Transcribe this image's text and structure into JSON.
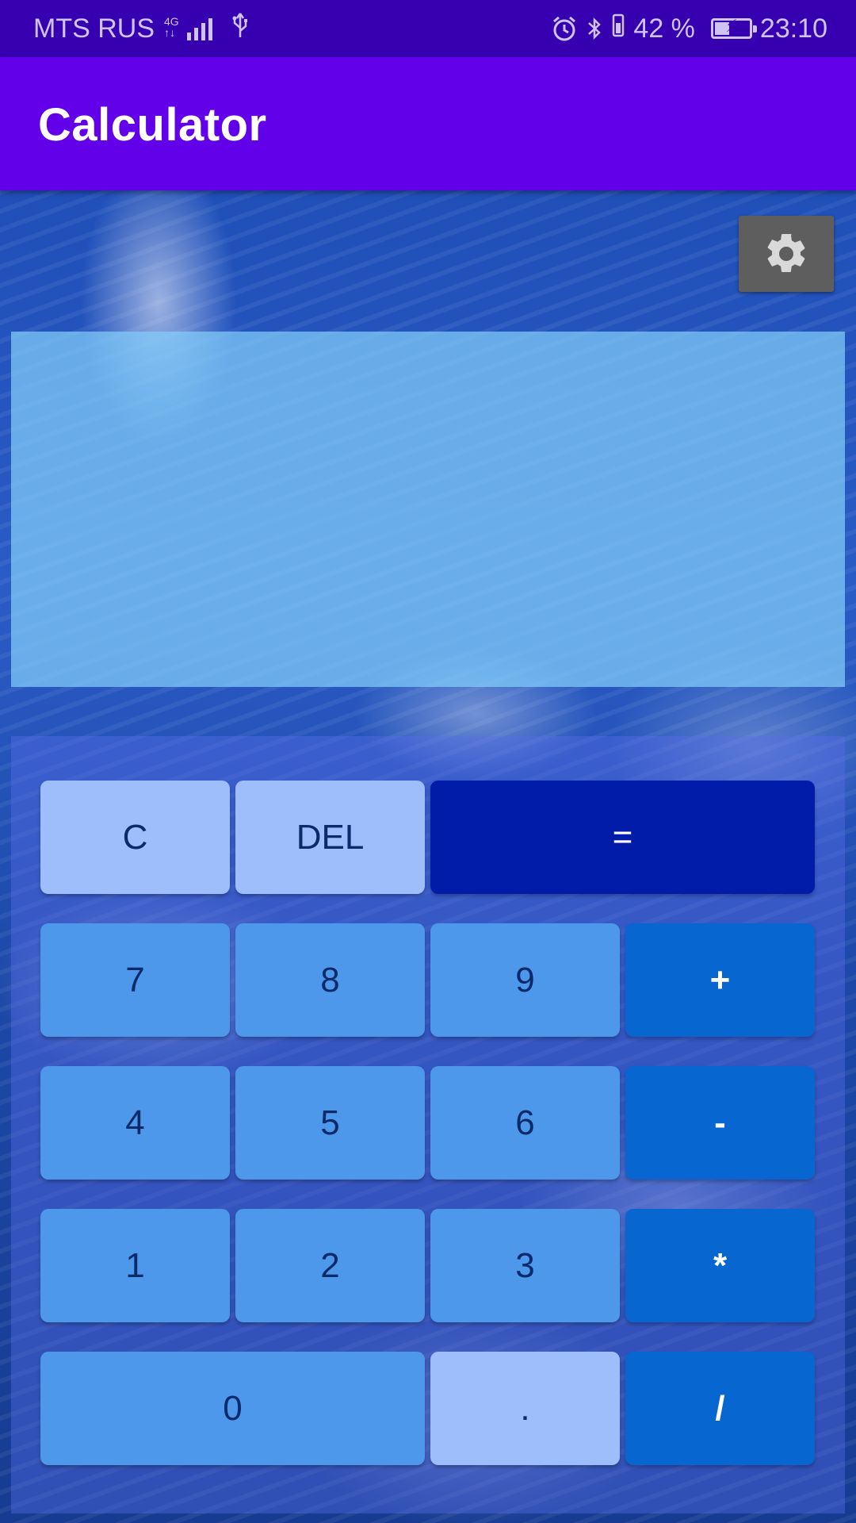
{
  "status_bar": {
    "carrier": "MTS RUS",
    "network_top": "4G",
    "network_bottom": "↑↓",
    "battery_percent": "42 %",
    "battery_level": 0.42,
    "time": "23:10",
    "icons": [
      "signal-icon",
      "usb-icon",
      "alarm-icon",
      "bluetooth-icon",
      "vibrate-icon",
      "battery-icon"
    ]
  },
  "app_bar": {
    "title": "Calculator"
  },
  "settings": {
    "icon": "gear-icon"
  },
  "display": {
    "value": ""
  },
  "keys": {
    "clear": "C",
    "delete": "DEL",
    "equals": "=",
    "seven": "7",
    "eight": "8",
    "nine": "9",
    "plus": "+",
    "four": "4",
    "five": "5",
    "six": "6",
    "minus": "-",
    "one": "1",
    "two": "2",
    "three": "3",
    "multiply": "*",
    "zero": "0",
    "decimal": ".",
    "divide": "/"
  },
  "colors": {
    "status_bar": "#3600b0",
    "app_bar": "#6200ea",
    "key_light": "#9dbdfb",
    "key_digit": "#4d98eb",
    "key_operator": "#0866d1",
    "key_equals": "#001ca8",
    "settings_button": "#5e5e5e"
  }
}
